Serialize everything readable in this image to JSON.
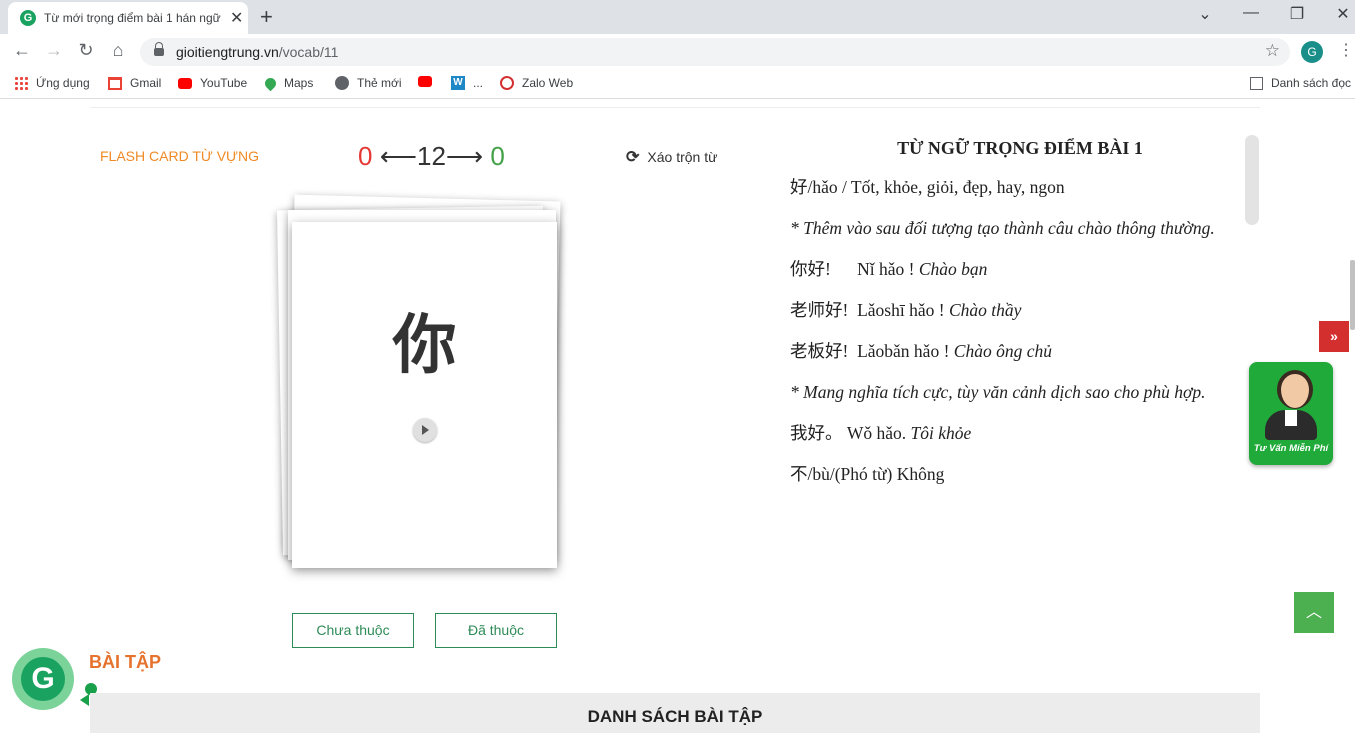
{
  "browser": {
    "tab_title": "Từ mới trọng điểm bài 1 hán ngữ",
    "tab_favicon": "G",
    "tab_close": "✕",
    "new_tab": "+",
    "win_controls": {
      "dropdown": "⌄",
      "minimize": "—",
      "restore": "❐",
      "close": "✕"
    },
    "url_domain": "gioitiengtrung.vn",
    "url_path": "/vocab/11",
    "profile_initial": "G",
    "bookmarks": [
      {
        "label": "Ứng dụng",
        "icon": "apps-grid-icon"
      },
      {
        "label": "Gmail",
        "icon": "gmail-icon"
      },
      {
        "label": "YouTube",
        "icon": "youtube-icon"
      },
      {
        "label": "Maps",
        "icon": "maps-icon"
      },
      {
        "label": "Thẻ mới",
        "icon": "globe-icon"
      },
      {
        "label": "",
        "icon": "youtube-icon"
      },
      {
        "label": "...",
        "icon": "word-icon"
      },
      {
        "label": "Zalo Web",
        "icon": "zalo-icon"
      }
    ],
    "reading_list": "Danh sách đọc"
  },
  "flashcard": {
    "section_title": "FLASH CARD TỪ VỰNG",
    "unknown_count": "0",
    "total": "12",
    "known_count": "0",
    "shuffle_label": "Xáo trộn từ",
    "hanzi": "你",
    "btn_not_learned": "Chưa thuộc",
    "btn_learned": "Đã thuộc"
  },
  "vocab": {
    "title": "TỪ NGỮ TRỌNG ĐIỂM BÀI 1",
    "lines": [
      {
        "main": " 好/hǎo / Tốt, khỏe, giỏi, đẹp, hay, ngon",
        "italic": ""
      },
      {
        "main": "",
        "italic": "* Thêm vào sau đối tượng tạo thành câu chào thông thường."
      },
      {
        "main": "你好!      Nǐ hǎo ! ",
        "italic": "Chào bạn"
      },
      {
        "main": "老师好!  Lǎoshī hǎo ! ",
        "italic": "Chào thầy"
      },
      {
        "main": "老板好!  Lǎobǎn hǎo ! ",
        "italic": "Chào ông chủ"
      },
      {
        "main": "",
        "italic": "* Mang nghĩa tích cực, tùy văn cảnh dịch sao cho phù hợp."
      },
      {
        "main": "我好。 Wǒ hǎo. ",
        "italic": "Tôi khỏe"
      },
      {
        "main": "不/bù/(Phó từ) Không",
        "italic": ""
      }
    ]
  },
  "side": {
    "support_label": "Tư Vấn Miễn Phí",
    "red_tab": "»",
    "back_to_top": "︿"
  },
  "exercises": {
    "logo": "G",
    "title": "BÀI TẬP",
    "list_title": "DANH SÁCH BÀI TẬP"
  }
}
